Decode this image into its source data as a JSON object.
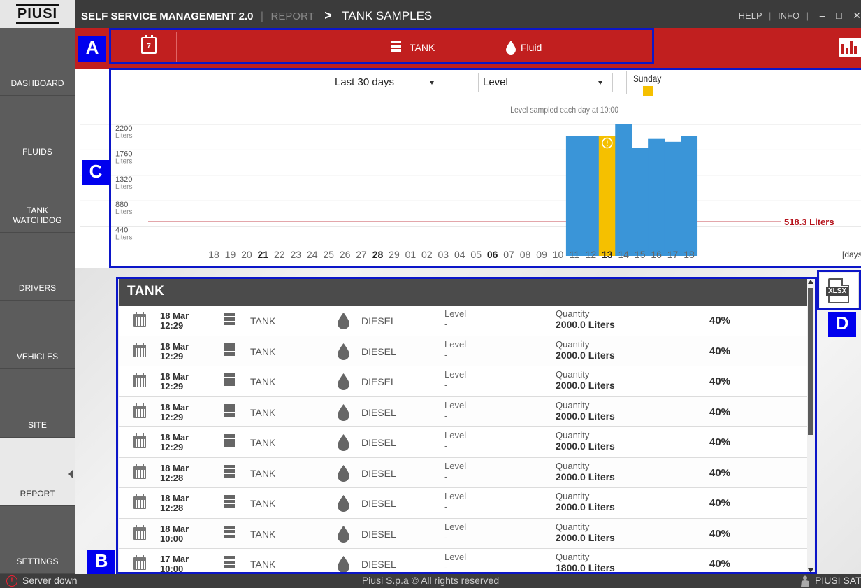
{
  "app": {
    "logo": "PIUSI",
    "title": "SELF SERVICE MANAGEMENT 2.0",
    "breadcrumb_parent": "REPORT",
    "breadcrumb_current": "TANK SAMPLES",
    "help_label": "HELP",
    "info_label": "INFO"
  },
  "sidebar": {
    "items": [
      {
        "label": "DASHBOARD"
      },
      {
        "label": "FLUIDS"
      },
      {
        "label": "TANK WATCHDOG"
      },
      {
        "label": "DRIVERS"
      },
      {
        "label": "VEHICLES"
      },
      {
        "label": "SITE"
      },
      {
        "label": "REPORT"
      },
      {
        "label": "SETTINGS"
      }
    ],
    "active": "REPORT"
  },
  "toolbar": {
    "calendar_day": "7",
    "tank_filter": "TANK",
    "fluid_filter": "Fluid"
  },
  "annotations": {
    "a": "A",
    "b": "B",
    "c": "C",
    "d": "D"
  },
  "chart_controls": {
    "period": "Last 30 days",
    "metric": "Level",
    "legend_sunday": "Sunday",
    "caption": "Level sampled each day at 10:00"
  },
  "chart_data": {
    "type": "bar",
    "categories": [
      "18",
      "19",
      "20",
      "21",
      "22",
      "23",
      "24",
      "25",
      "26",
      "27",
      "28",
      "29",
      "01",
      "02",
      "03",
      "04",
      "05",
      "06",
      "07",
      "08",
      "09",
      "10",
      "11",
      "12",
      "13",
      "14",
      "15",
      "16",
      "17",
      "18"
    ],
    "bold_categories": [
      "21",
      "28",
      "06",
      "13"
    ],
    "values": [
      null,
      null,
      null,
      null,
      null,
      null,
      null,
      null,
      null,
      null,
      null,
      null,
      null,
      null,
      null,
      null,
      null,
      null,
      null,
      null,
      null,
      null,
      2000,
      2000,
      2000,
      2200,
      1800,
      1950,
      1900,
      2000
    ],
    "highlight_category_index": 24,
    "highlight_color": "#f5c000",
    "bar_color": "#3a95d8",
    "warning_on_highlight": true,
    "threshold_value": 518.3,
    "threshold_label": "518.3 Liters",
    "threshold_color": "#b5121b",
    "yticks": [
      {
        "value": 2200,
        "label": "2200"
      },
      {
        "value": 1760,
        "label": "1760"
      },
      {
        "value": 1320,
        "label": "1320"
      },
      {
        "value": 880,
        "label": "880"
      },
      {
        "value": 440,
        "label": "440"
      }
    ],
    "yunit": "Liters",
    "xlabel": "[days]",
    "ylim": [
      0,
      2200
    ]
  },
  "table": {
    "title": "TANK",
    "rows": [
      {
        "date": "18 Mar",
        "time": "12:29",
        "tank": "TANK",
        "fluid": "DIESEL",
        "level_label": "Level",
        "level": "-",
        "qty_label": "Quantity",
        "qty": "2000.0 Liters",
        "pct": "40%"
      },
      {
        "date": "18 Mar",
        "time": "12:29",
        "tank": "TANK",
        "fluid": "DIESEL",
        "level_label": "Level",
        "level": "-",
        "qty_label": "Quantity",
        "qty": "2000.0 Liters",
        "pct": "40%"
      },
      {
        "date": "18 Mar",
        "time": "12:29",
        "tank": "TANK",
        "fluid": "DIESEL",
        "level_label": "Level",
        "level": "-",
        "qty_label": "Quantity",
        "qty": "2000.0 Liters",
        "pct": "40%"
      },
      {
        "date": "18 Mar",
        "time": "12:29",
        "tank": "TANK",
        "fluid": "DIESEL",
        "level_label": "Level",
        "level": "-",
        "qty_label": "Quantity",
        "qty": "2000.0 Liters",
        "pct": "40%"
      },
      {
        "date": "18 Mar",
        "time": "12:29",
        "tank": "TANK",
        "fluid": "DIESEL",
        "level_label": "Level",
        "level": "-",
        "qty_label": "Quantity",
        "qty": "2000.0 Liters",
        "pct": "40%"
      },
      {
        "date": "18 Mar",
        "time": "12:28",
        "tank": "TANK",
        "fluid": "DIESEL",
        "level_label": "Level",
        "level": "-",
        "qty_label": "Quantity",
        "qty": "2000.0 Liters",
        "pct": "40%"
      },
      {
        "date": "18 Mar",
        "time": "12:28",
        "tank": "TANK",
        "fluid": "DIESEL",
        "level_label": "Level",
        "level": "-",
        "qty_label": "Quantity",
        "qty": "2000.0 Liters",
        "pct": "40%"
      },
      {
        "date": "18 Mar",
        "time": "10:00",
        "tank": "TANK",
        "fluid": "DIESEL",
        "level_label": "Level",
        "level": "-",
        "qty_label": "Quantity",
        "qty": "2000.0 Liters",
        "pct": "40%"
      },
      {
        "date": "17 Mar",
        "time": "10:00",
        "tank": "TANK",
        "fluid": "DIESEL",
        "level_label": "Level",
        "level": "-",
        "qty_label": "Quantity",
        "qty": "1800.0 Liters",
        "pct": "40%"
      }
    ]
  },
  "export": {
    "label": "XLSX"
  },
  "status": {
    "server": "Server down",
    "copyright": "Piusi S.p.a © All rights reserved",
    "user": "PIUSI SAT"
  },
  "colors": {
    "brand_red": "#c11f1f",
    "sidebar": "#5c5c5c",
    "topbar": "#3b3b3b",
    "annotation_blue": "#0000ee"
  }
}
